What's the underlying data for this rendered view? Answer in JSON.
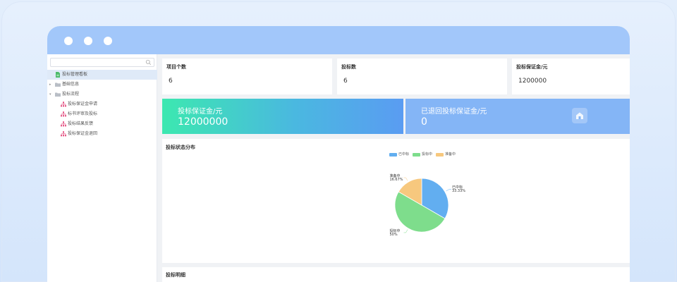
{
  "sidebar": {
    "search": {
      "placeholder": "",
      "value": ""
    },
    "items": [
      {
        "label": "投标管理看板",
        "icon": "document-icon",
        "active": true
      },
      {
        "label": "基础信息",
        "icon": "folder-icon"
      },
      {
        "label": "投标流程",
        "icon": "folder-icon"
      },
      {
        "label": "投标保证金申请",
        "icon": "org-chart-icon"
      },
      {
        "label": "标书评审及投标",
        "icon": "org-chart-icon"
      },
      {
        "label": "投标结果反馈",
        "icon": "org-chart-icon"
      },
      {
        "label": "投标保证金退回",
        "icon": "org-chart-icon"
      }
    ]
  },
  "stats": [
    {
      "title": "项目个数",
      "value": "6"
    },
    {
      "title": "投标数",
      "value": "6"
    },
    {
      "title": "投标保证金/元",
      "value": "1200000"
    }
  ],
  "banners": [
    {
      "title": "投标保证金/元",
      "value": "12000000"
    },
    {
      "title": "已退回投标保证金/元",
      "value": "0"
    }
  ],
  "chart_card_title": "投标状态分布",
  "chart_data": {
    "type": "pie",
    "title": "投标状态分布",
    "legend_position": "top",
    "slices": [
      {
        "name": "已中标",
        "percent": 33.33,
        "label": "33.33%",
        "color": "#62aef0"
      },
      {
        "name": "投标中",
        "percent": 50,
        "label": "50%",
        "color": "#7edd8c"
      },
      {
        "name": "准备中",
        "percent": 16.67,
        "label": "16.67%",
        "color": "#f7c87e"
      }
    ]
  },
  "detail_title": "投标明细",
  "colors": {
    "titlebar": "#a2c7fa",
    "active_item": "#dfeaf8",
    "banner2": "#84b5f6"
  }
}
